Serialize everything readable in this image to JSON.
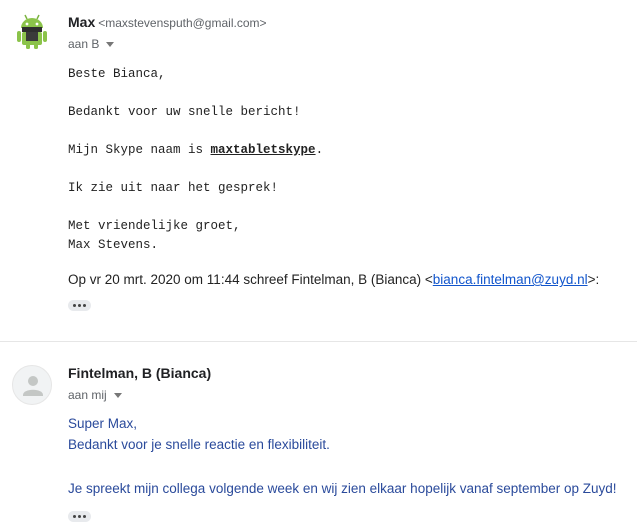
{
  "message1": {
    "sender_name": "Max",
    "sender_email": "<maxstevensputh@gmail.com>",
    "recipient": "aan B",
    "avatar_icon": "android-avatar-icon",
    "greeting": "Beste Bianca,",
    "line_thanks": "Bedankt voor uw snelle bericht!",
    "skype_prefix": "Mijn Skype naam is ",
    "skype_name": "maxtabletskype",
    "skype_suffix": ".",
    "line_look_forward": "Ik zie uit naar het gesprek!",
    "closing": "Met vriendelijke groet,",
    "signature": "Max Stevens.",
    "quote_intro": "Op vr 20 mrt. 2020 om 11:44 schreef Fintelman, B (Bianca) <",
    "quote_email": "bianca.fintelman@zuyd.nl",
    "quote_end": ">:"
  },
  "message2": {
    "sender_name": "Fintelman, B (Bianca)",
    "recipient": "aan mij",
    "avatar_icon": "default-person-icon",
    "line1": "Super Max,",
    "line2": "Bedankt voor je snelle reactie en flexibiliteit.",
    "line3": "Je spreekt mijn collega volgende week en wij zien elkaar hopelijk vanaf september op Zuyd!"
  },
  "colors": {
    "blue_text": "#2a4a9b",
    "link": "#1155cc",
    "android_green": "#8bc34a"
  }
}
